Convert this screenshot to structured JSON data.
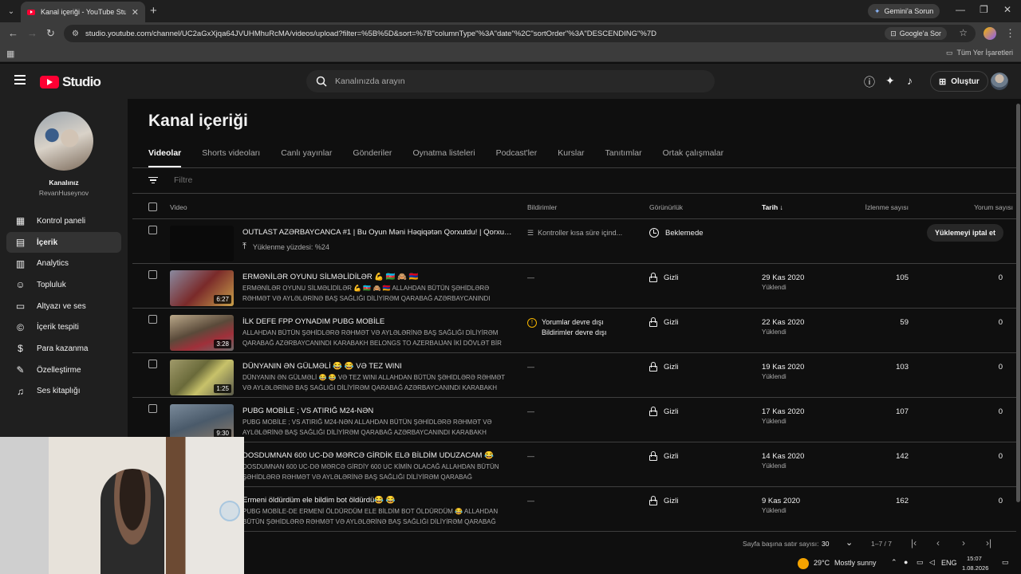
{
  "browser": {
    "tab_title": "Kanal içeriği - YouTube Studio",
    "url": "studio.youtube.com/channel/UC2aGxXjqa64JVUHMhuRcMA/videos/upload?filter=%5B%5D&sort=%7B\"columnType\"%3A\"date\"%2C\"sortOrder\"%3A\"DESCENDING\"%7D",
    "gemini_label": "Gemini'a Sorun",
    "google_ask_label": "Google'a Sor",
    "bookmarks_label": "Tüm Yer İşaretleri"
  },
  "header": {
    "logo_text": "Studio",
    "search_placeholder": "Kanalınızda arayın",
    "create_label": "Oluştur"
  },
  "sidebar": {
    "channel_label": "Kanalınız",
    "channel_name": "RevanHuseynov",
    "items": [
      {
        "label": "Kontrol paneli",
        "icon": "dashboard-icon"
      },
      {
        "label": "İçerik",
        "icon": "content-icon",
        "active": true
      },
      {
        "label": "Analytics",
        "icon": "analytics-icon"
      },
      {
        "label": "Topluluk",
        "icon": "community-icon"
      },
      {
        "label": "Altyazı ve ses",
        "icon": "subtitles-icon"
      },
      {
        "label": "İçerik tespiti",
        "icon": "copyright-icon"
      },
      {
        "label": "Para kazanma",
        "icon": "monetization-icon"
      },
      {
        "label": "Özelleştirme",
        "icon": "customization-icon"
      },
      {
        "label": "Ses kitaplığı",
        "icon": "audio-library-icon"
      }
    ]
  },
  "main": {
    "title": "Kanal içeriği",
    "tabs": [
      "Videolar",
      "Shorts videoları",
      "Canlı yayınlar",
      "Gönderiler",
      "Oynatma listeleri",
      "Podcast'ler",
      "Kurslar",
      "Tanıtımlar",
      "Ortak çalışmalar"
    ],
    "filter_placeholder": "Filtre",
    "columns": {
      "video": "Video",
      "restrictions": "Bildirimler",
      "visibility": "Görünürlük",
      "date": "Tarih",
      "views": "İzlenme sayısı",
      "comments": "Yorum sayısı"
    }
  },
  "upload_row": {
    "title": "OUTLAST AZƏRBAYCANCA #1 | Bu Oyun Məni Həqiqətən Qorxutdu! | Qorxu Ga...",
    "progress_text": "Yüklenme yüzdesi: %24",
    "progress": 0.24,
    "restriction": "Kontroller kısa süre içind...",
    "visibility": "Beklemede",
    "cancel_label": "Yüklemeyi iptal et"
  },
  "videos": [
    {
      "title": "ERMƏNİLƏR OYUNU SİLMƏLİDİLƏR 💪 🇦🇿 🙈 🇦🇲",
      "desc": "ERMƏNİLƏR OYUNU SİLMƏLİDİLƏR 💪 🇦🇿 🙈 🇦🇲 ALLAHDAN BÜTÜN ŞƏHİDLƏRƏ RƏHMƏT VƏ AYLƏLƏRİNƏ BAŞ SAĞLIĞI DİLİYİRƏM QARABAĞ AZƏRBAYCANINDI KARABAKH BELONGS T...",
      "duration": "6:27",
      "restriction": "—",
      "visibility": "Gizli",
      "date": "29 Kas 2020",
      "date_sub": "Yüklendi",
      "views": "105",
      "comments": "0",
      "thumb": "#7a2a2a"
    },
    {
      "title": "İLK DEFE FPP OYNADIM PUBG MOBİLE",
      "desc": "ALLAHDAN BÜTÜN ŞƏHİDLƏRƏ RƏHMƏT VƏ AYLƏLƏRİNƏ BAŞ SAĞLIĞI DİLİYİRƏM QARABAĞ AZƏRBAYCANINDI KARABAKH BELONGS TO AZERBAIJAN İKİ DÖVLƏT BİR MİLLƏ...",
      "duration": "3:28",
      "restriction_warn": [
        "Yorumlar devre dışı",
        "Bildirimler devre dışı"
      ],
      "visibility": "Gizli",
      "date": "22 Kas 2020",
      "date_sub": "Yüklendi",
      "views": "59",
      "comments": "0",
      "thumb": "#5a4a3a"
    },
    {
      "title": "DÜNYANIN ƏN GÜLMƏLİ 😂 😂 VƏ TEZ WINI",
      "desc": "DÜNYANIN ƏN GÜLMƏLİ 😂 😂 VƏ TEZ WINI ALLAHDAN BÜTÜN ŞƏHİDLƏRƏ RƏHMƏT VƏ AYLƏLƏRİNƏ BAŞ SAĞLIĞI DİLİYİRƏM QARABAĞ AZƏRBAYCANINDI KARABAKH BELONGS T...",
      "duration": "1:25",
      "restriction": "—",
      "visibility": "Gizli",
      "date": "19 Kas 2020",
      "date_sub": "Yüklendi",
      "views": "103",
      "comments": "0",
      "thumb": "#6a6a3a"
    },
    {
      "title": "PUBG MOBİLE ; VS ATIRIĞ M24-NƏN",
      "desc": "PUBG MOBİLE ; VS ATIRIĞ M24-NƏN ALLAHDAN BÜTÜN ŞƏHİDLƏRƏ RƏHMƏT VƏ AYLƏLƏRİNƏ BAŞ SAĞLIĞI DİLİYİRƏM QARABAĞ AZƏRBAYCANINDI KARABAKH BELONGS T...",
      "duration": "9:30",
      "restriction": "—",
      "visibility": "Gizli",
      "date": "17 Kas 2020",
      "date_sub": "Yüklendi",
      "views": "107",
      "comments": "0",
      "thumb": "#4a5a6a"
    },
    {
      "title": "DOSDUMNAN 600 UC-DƏ MƏRCƏ GİRDİK ELƏ BİLDİM UDUZACAM 😂",
      "desc": "DOSDUMNAN 600 UC-DƏ MƏRCƏ GİRDİY 600 UC KİMİN OLACAĞ ALLAHDAN BÜTÜN ŞƏHİDLƏRƏ RƏHMƏT VƏ AYLƏLƏRİNƏ BAŞ SAĞLIĞI DİLİYİRƏM QARABAĞ AZƏRBAYCANIN...",
      "duration": "",
      "restriction": "—",
      "visibility": "Gizli",
      "date": "14 Kas 2020",
      "date_sub": "Yüklendi",
      "views": "142",
      "comments": "0",
      "thumb": "#3a3a3a"
    },
    {
      "title": "Ermeni öldürdüm ele bildim bot öldürdü😂 😂",
      "desc": "PUBG MOBİLE-DE ERMENİ ÖLDÜRDÜM ELE BİLDİM BOT ÖLDÜRDÜM 😂 ALLAHDAN BÜTÜN ŞƏHİDLƏRƏ RƏHMƏT VƏ AYLƏLƏRİNƏ BAŞ SAĞLIĞI DİLİYİRƏM QARABAĞ AZƏRBAYCANIN...",
      "duration": "",
      "restriction": "—",
      "visibility": "Gizli",
      "date": "9 Kas 2020",
      "date_sub": "Yüklendi",
      "views": "162",
      "comments": "0",
      "thumb": "#3a3a3a"
    }
  ],
  "pager": {
    "rows_label": "Sayfa başına satır sayısı:",
    "rows_value": "30",
    "range": "1–7 / 7"
  },
  "taskbar": {
    "weather": "29°C",
    "weather_desc": "Mostly sunny",
    "lang": "ENG",
    "time": "15:07",
    "date": "1.08.2026"
  }
}
